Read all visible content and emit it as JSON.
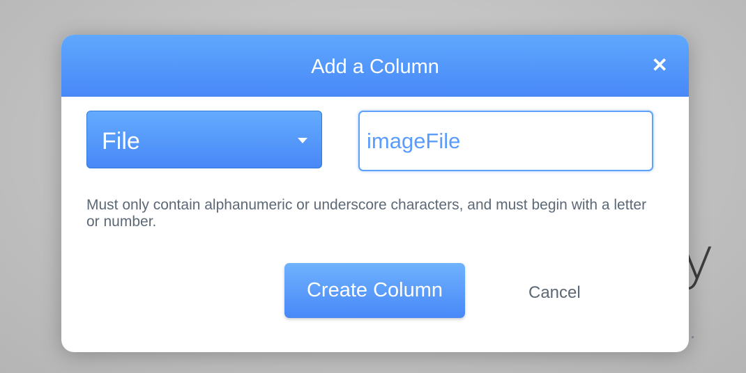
{
  "background": {
    "partial_text": "y"
  },
  "dialog": {
    "title": "Add a Column",
    "close_icon": "close-icon",
    "type_select": {
      "value": "File"
    },
    "name_input": {
      "value": "imageFile"
    },
    "help_text": "Must only contain alphanumeric or underscore characters, and must begin with a letter or number.",
    "create_label": "Create Column",
    "cancel_label": "Cancel"
  },
  "colors": {
    "accent": "#4a8cf8",
    "header_top": "#5fa8fd",
    "help_text": "#5c6876"
  }
}
